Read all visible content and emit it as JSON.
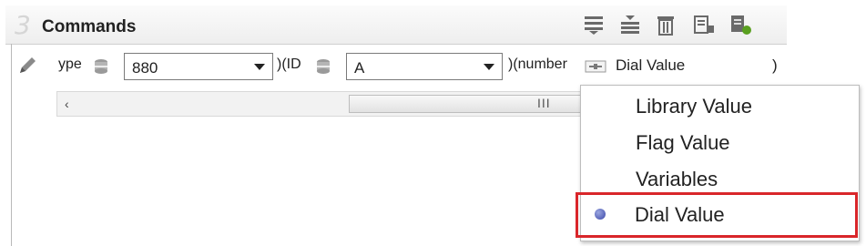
{
  "header": {
    "number": "3",
    "title": "Commands",
    "toolbar_icons": [
      "align-icon",
      "sort-icon",
      "trash-icon",
      "properties-icon",
      "add-icon"
    ]
  },
  "row": {
    "type_label": "ype",
    "type_value": "880",
    "id_label": ")(ID",
    "id_value": "A",
    "number_label": ")(number",
    "number_value": "Dial Value",
    "close_paren": ")"
  },
  "scrollbar": {
    "left_arrow": "‹",
    "grip": "III"
  },
  "menu": {
    "items": [
      {
        "label": "Library Value",
        "selected": false
      },
      {
        "label": "Flag Value",
        "selected": false
      },
      {
        "label": "Variables",
        "selected": false
      },
      {
        "label": "Dial Value",
        "selected": true
      }
    ]
  },
  "colors": {
    "highlight": "#d9262a",
    "accent_green": "#5aa020"
  }
}
